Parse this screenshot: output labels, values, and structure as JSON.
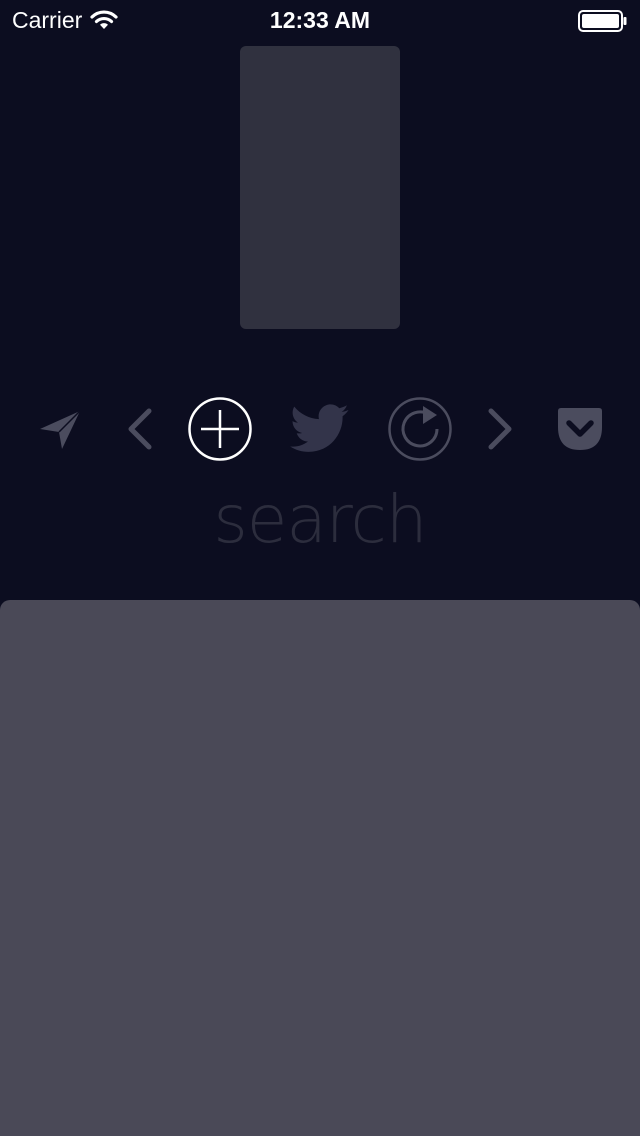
{
  "status_bar": {
    "carrier": "Carrier",
    "time": "12:33 AM",
    "wifi_icon": "wifi-icon",
    "battery_icon": "battery-icon"
  },
  "toolbar": {
    "items": [
      {
        "icon": "send-icon",
        "state": "inactive"
      },
      {
        "icon": "chevron-left-icon",
        "state": "inactive"
      },
      {
        "icon": "add-circle-icon",
        "state": "active"
      },
      {
        "icon": "twitter-bird-icon",
        "state": "inactive"
      },
      {
        "icon": "refresh-icon",
        "state": "inactive"
      },
      {
        "icon": "chevron-right-icon",
        "state": "inactive"
      },
      {
        "icon": "pocket-icon",
        "state": "inactive"
      }
    ]
  },
  "search": {
    "label": "search"
  },
  "colors": {
    "background": "#0c0d20",
    "card": "#30313f",
    "panel": "#4a4957",
    "icon_inactive": "#4b4c5e",
    "icon_active": "#ffffff",
    "search_text": "#2c2d3d"
  }
}
